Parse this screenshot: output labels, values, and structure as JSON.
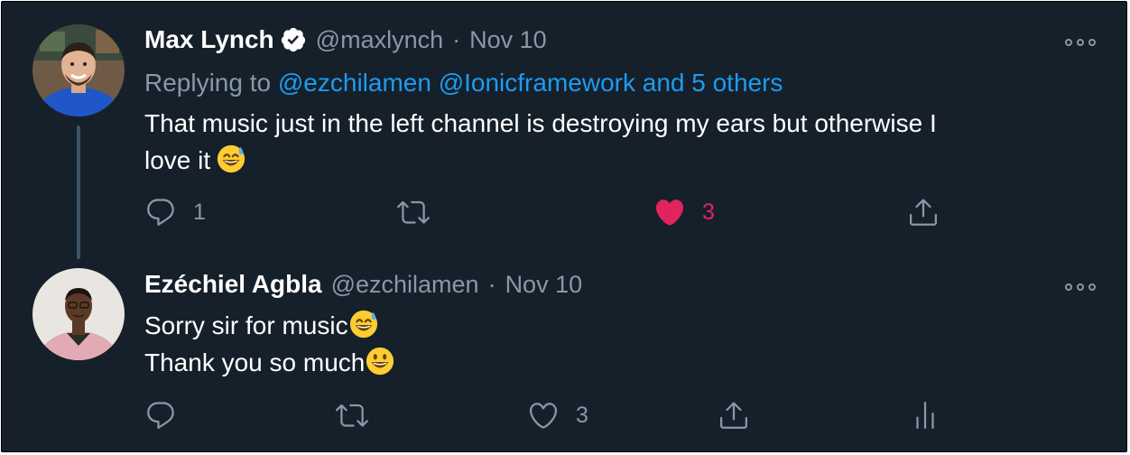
{
  "tweets": [
    {
      "author": {
        "name": "Max Lynch",
        "handle": "@maxlynch",
        "verified": true
      },
      "date": "Nov 10",
      "replying": {
        "prefix": "Replying to",
        "mentions": "@ezchilamen @Ionicframework",
        "others": "and 5 others"
      },
      "text_lines": [
        "That music just in the left channel is destroying my ears but otherwise I",
        "love it"
      ],
      "emojis": [
        "grinning-sweat-emoji"
      ],
      "actions": {
        "reply_count": "1",
        "retweet_count": "",
        "like_count": "3",
        "liked": true
      }
    },
    {
      "author": {
        "name": "Ezéchiel Agbla",
        "handle": "@ezchilamen",
        "verified": false
      },
      "date": "Nov 10",
      "text_lines": [
        "Sorry sir for music",
        "Thank you so much"
      ],
      "emojis": [
        "grinning-sweat-emoji",
        "smiley-emoji"
      ],
      "actions": {
        "reply_count": "",
        "retweet_count": "",
        "like_count": "3",
        "liked": false
      }
    }
  ],
  "ui": {
    "separator": "·"
  },
  "colors": {
    "background": "#15202b",
    "text": "#ffffff",
    "muted": "#8899a6",
    "link": "#1d9bf0",
    "like": "#e0245e",
    "verified": "#ffffff",
    "thread_line": "#3d5466"
  }
}
